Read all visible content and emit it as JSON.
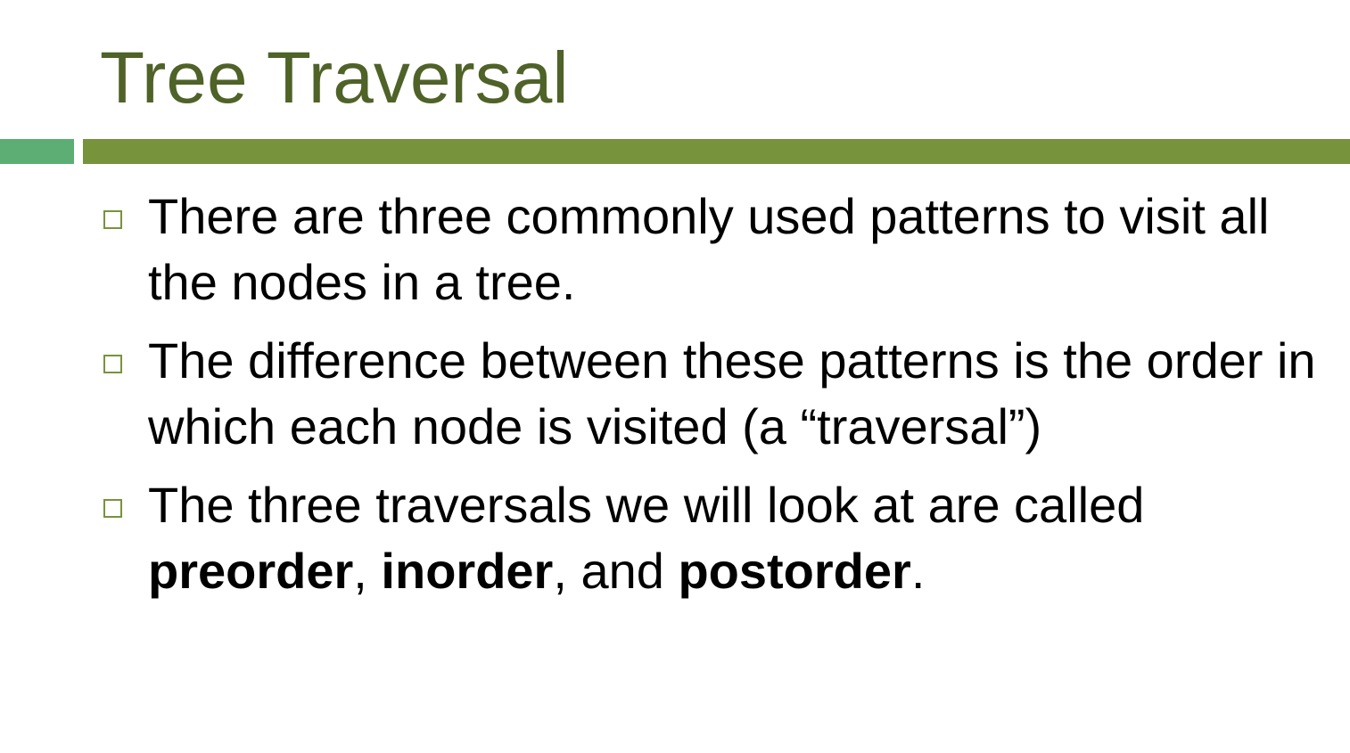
{
  "slide": {
    "title": "Tree Traversal",
    "colors": {
      "title": "#4f6228",
      "accent_bar_left": "#5cae74",
      "accent_bar_main": "#77933c",
      "bullet_marker": "#77933c"
    },
    "bullet_marker_icon": "hollow-square-icon",
    "bullets": [
      {
        "text": "There are three commonly used patterns to visit all the nodes in a tree."
      },
      {
        "text": "The difference between these patterns is the order in which each node is visited (a “traversal”)"
      },
      {
        "parts": {
          "lead": "The three traversals we will look at are called ",
          "term1": "preorder",
          "sep1": ", ",
          "term2": "inorder",
          "sep2": ", and ",
          "term3": "postorder",
          "end": "."
        }
      }
    ]
  }
}
